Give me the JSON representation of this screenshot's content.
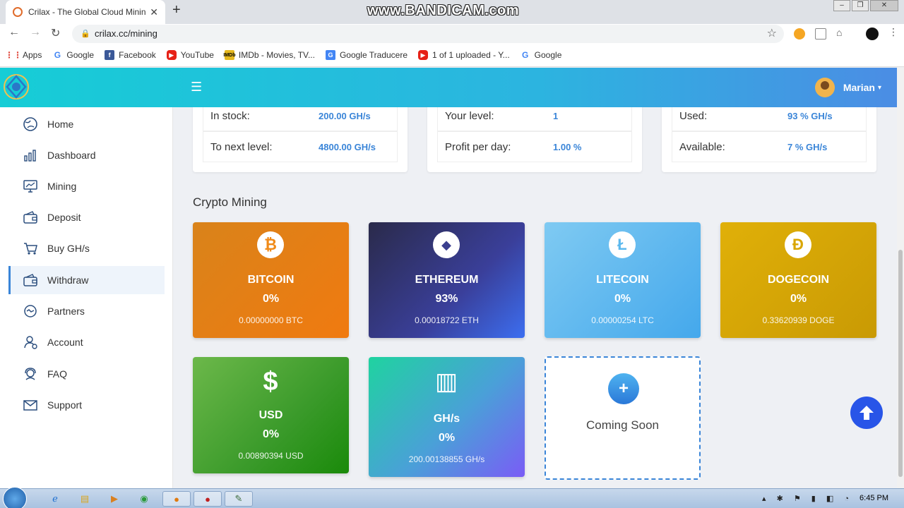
{
  "browser": {
    "tab_title": "Crilax - The Global Cloud Mining",
    "new_tab": "+",
    "url": "crilax.cc/mining",
    "bookmarks": [
      {
        "label": "Apps",
        "icon": "apps-grid-icon",
        "color": "#e04a3f"
      },
      {
        "label": "Google",
        "icon": "google-icon",
        "color": "#4285f4"
      },
      {
        "label": "Facebook",
        "icon": "facebook-icon",
        "color": "#3b5998"
      },
      {
        "label": "YouTube",
        "icon": "youtube-icon",
        "color": "#e62117"
      },
      {
        "label": "IMDb - Movies, TV...",
        "icon": "imdb-icon",
        "color": "#e6b91e"
      },
      {
        "label": "Google Traducere",
        "icon": "translate-icon",
        "color": "#4285f4"
      },
      {
        "label": "1 of 1 uploaded - Y...",
        "icon": "youtube-icon",
        "color": "#e62117"
      },
      {
        "label": "Google",
        "icon": "google-icon",
        "color": "#4285f4"
      }
    ]
  },
  "watermark": "www.BANDICAM.com",
  "header": {
    "menu_icon": "☰",
    "user_name": "Marian",
    "accent": "#3a85d8"
  },
  "sidebar": {
    "items": [
      {
        "label": "Home",
        "icon": "globe-icon"
      },
      {
        "label": "Dashboard",
        "icon": "chart-icon"
      },
      {
        "label": "Mining",
        "icon": "monitor-icon"
      },
      {
        "label": "Deposit",
        "icon": "wallet-icon"
      },
      {
        "label": "Buy GH/s",
        "icon": "cart-icon"
      },
      {
        "label": "Withdraw",
        "icon": "wallet-icon",
        "active": true
      },
      {
        "label": "Partners",
        "icon": "handshake-icon"
      },
      {
        "label": "Account",
        "icon": "user-icon"
      },
      {
        "label": "FAQ",
        "icon": "support-icon"
      },
      {
        "label": "Support",
        "icon": "mail-icon"
      }
    ]
  },
  "stats": {
    "in_stock_label": "In stock:",
    "in_stock_value": "200.00 GH/s",
    "next_level_label": "To next level:",
    "next_level_value": "4800.00 GH/s",
    "your_level_label": "Your level:",
    "your_level_value": "1",
    "profit_label": "Profit per day:",
    "profit_value": "1.00 %",
    "used_label": "Used:",
    "used_value": "93 % GH/s",
    "available_label": "Available:",
    "available_value": "7 % GH/s"
  },
  "mining": {
    "section_title": "Crypto Mining",
    "cards": [
      {
        "name": "BITCOIN",
        "percent": "0%",
        "amount": "0.00000000 BTC",
        "icon_glyph": "₿",
        "icon_color": "#f08a18"
      },
      {
        "name": "ETHEREUM",
        "percent": "93%",
        "amount": "0.00018722 ETH",
        "icon_glyph": "◆",
        "icon_color": "#3b3f8f"
      },
      {
        "name": "LITECOIN",
        "percent": "0%",
        "amount": "0.00000254 LTC",
        "icon_glyph": "Ł",
        "icon_color": "#5cb9ee"
      },
      {
        "name": "DOGECOIN",
        "percent": "0%",
        "amount": "0.33620939 DOGE",
        "icon_glyph": "Ð",
        "icon_color": "#d9a600"
      },
      {
        "name": "USD",
        "percent": "0%",
        "amount": "0.00890394 USD",
        "icon_glyph": "$"
      },
      {
        "name": "GH/s",
        "percent": "0%",
        "amount": "200.00138855 GH/s",
        "icon_glyph": "▥"
      }
    ],
    "coming_soon": "Coming Soon",
    "plus": "+"
  },
  "taskbar": {
    "clock": "6:45 PM"
  }
}
